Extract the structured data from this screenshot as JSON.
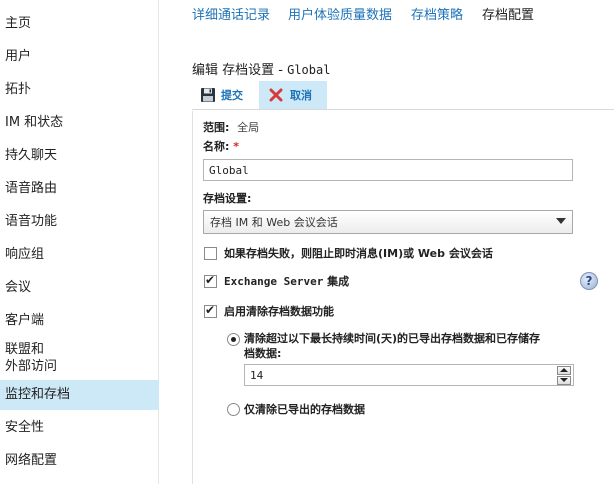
{
  "sidebar": {
    "items": [
      {
        "label": "主页"
      },
      {
        "label": "用户"
      },
      {
        "label": "拓扑"
      },
      {
        "label": "IM 和状态"
      },
      {
        "label": "持久聊天"
      },
      {
        "label": "语音路由"
      },
      {
        "label": "语音功能"
      },
      {
        "label": "响应组"
      },
      {
        "label": "会议"
      },
      {
        "label": "客户端"
      },
      {
        "label_line1": "联盟和",
        "label_line2": "外部访问"
      },
      {
        "label": "监控和存档"
      },
      {
        "label": "安全性"
      },
      {
        "label": "网络配置"
      }
    ]
  },
  "tabs": [
    {
      "label": "详细通话记录"
    },
    {
      "label": "用户体验质量数据"
    },
    {
      "label": "存档策略"
    },
    {
      "label": "存档配置"
    }
  ],
  "page_title": {
    "prefix": "编辑 存档设置 - ",
    "name": "Global"
  },
  "toolbar": {
    "commit_label": "提交",
    "cancel_label": "取消"
  },
  "form": {
    "scope_label": "范围:",
    "scope_value": "全局",
    "name_label": "名称:",
    "required_mark": "*",
    "name_value": "Global",
    "archive_settings_label": "存档设置:",
    "archive_settings_value": "存档 IM 和 Web 会议会话",
    "block_on_failure_label": "如果存档失败，则阻止即时消息(IM)或 Web 会议会话",
    "exchange_label_bold": "Exchange Server",
    "exchange_label_rest": " 集成",
    "enable_purge_label": "启用清除存档数据功能",
    "purge_older_label_line1": "清除超过以下最长持续时间(天)的已导出存档数据和已存储存",
    "purge_older_label_line2": "档数据:",
    "days_value": "14",
    "purge_exported_only_label": "仅清除已导出的存档数据",
    "help_glyph": "?"
  },
  "colors": {
    "accent": "#1e73b8",
    "selected_bg": "#cde8f6",
    "required": "#dd2222",
    "cancel_icon": "#d63a3a"
  }
}
